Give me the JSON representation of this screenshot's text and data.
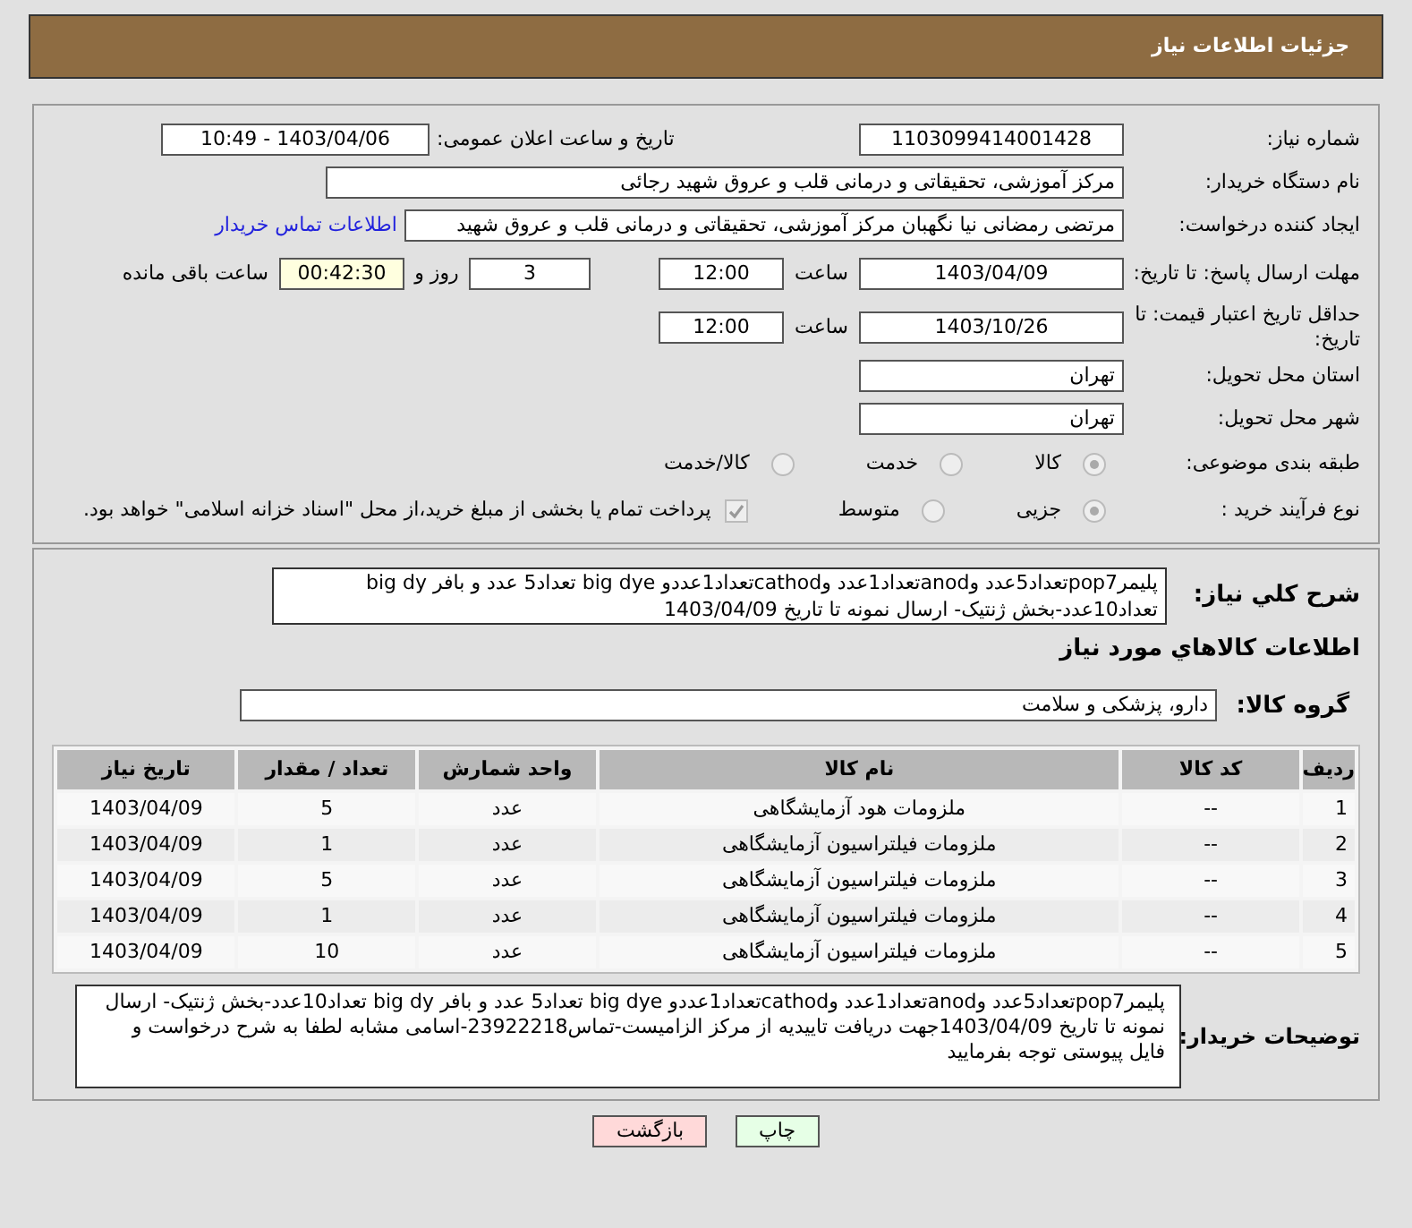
{
  "title": "جزئیات اطلاعات نیاز",
  "need_number": {
    "label": "شماره نیاز:",
    "value": "1103099414001428"
  },
  "announce": {
    "label": "تاریخ و ساعت اعلان عمومی:",
    "value": "1403/04/06 - 10:49"
  },
  "buyer_org": {
    "label": "نام دستگاه خریدار:",
    "value": "مرکز آموزشی، تحقیقاتی و درمانی قلب و عروق شهید رجائی"
  },
  "requester": {
    "label": "ایجاد کننده درخواست:",
    "value": "مرتضی رمضانی نیا نگهبان مرکز آموزشی، تحقیقاتی و درمانی قلب و عروق شهید",
    "link": "اطلاعات تماس خریدار"
  },
  "reply_deadline": {
    "label": "مهلت ارسال پاسخ: تا تاریخ:",
    "date": "1403/04/09",
    "time_label": "ساعت",
    "time": "12:00",
    "days": "3",
    "days_label": "روز و",
    "remaining": "00:42:30",
    "remaining_label": "ساعت باقی مانده"
  },
  "price_validity": {
    "label": "حداقل تاریخ اعتبار قیمت: تا تاریخ:",
    "date": "1403/10/26",
    "time_label": "ساعت",
    "time": "12:00"
  },
  "province": {
    "label": "استان محل تحویل:",
    "value": "تهران"
  },
  "city": {
    "label": "شهر محل تحویل:",
    "value": "تهران"
  },
  "category": {
    "label": "طبقه بندی موضوعی:",
    "options": [
      {
        "label": "کالا",
        "selected": true
      },
      {
        "label": "خدمت",
        "selected": false
      },
      {
        "label": "کالا/خدمت",
        "selected": false
      }
    ]
  },
  "purchase_type": {
    "label": "نوع فرآیند خرید :",
    "options": [
      {
        "label": "جزیی",
        "selected": true
      },
      {
        "label": "متوسط",
        "selected": false
      }
    ],
    "treasury": {
      "label": "پرداخت تمام یا بخشی از مبلغ خرید،از محل \"اسناد خزانه اسلامی\" خواهد بود.",
      "checked": true
    }
  },
  "description": {
    "label": "شرح کلي نياز:",
    "value": "پلیمرpop7تعداد5عدد وanodتعداد1عدد وcathodتعداد1عددو big dye تعداد5 عدد و بافر big dy تعداد10عدد-بخش ژنتیک- ارسال نمونه  تا تاریخ 1403/04/09"
  },
  "items_title": "اطلاعات کالاهاي مورد نياز",
  "goods_group": {
    "label": "گروه کالا:",
    "value": "دارو، پزشکی و سلامت"
  },
  "table": {
    "columns": [
      "ردیف",
      "کد کالا",
      "نام کالا",
      "واحد شمارش",
      "تعداد / مقدار",
      "تاریخ نیاز"
    ],
    "rows": [
      [
        "1",
        "--",
        "ملزومات هود آزمایشگاهی",
        "عدد",
        "5",
        "1403/04/09"
      ],
      [
        "2",
        "--",
        "ملزومات فیلتراسیون آزمایشگاهی",
        "عدد",
        "1",
        "1403/04/09"
      ],
      [
        "3",
        "--",
        "ملزومات فیلتراسیون آزمایشگاهی",
        "عدد",
        "5",
        "1403/04/09"
      ],
      [
        "4",
        "--",
        "ملزومات فیلتراسیون آزمایشگاهی",
        "عدد",
        "1",
        "1403/04/09"
      ],
      [
        "5",
        "--",
        "ملزومات فیلتراسیون آزمایشگاهی",
        "عدد",
        "10",
        "1403/04/09"
      ]
    ]
  },
  "buyer_notes": {
    "label": "توضیحات خریدار:",
    "value": "پلیمرpop7تعداد5عدد وanodتعداد1عدد وcathodتعداد1عددو big dye تعداد5 عدد و بافر big dy تعداد10عدد-بخش ژنتیک- ارسال نمونه  تا تاریخ 1403/04/09جهت دریافت تاییدیه از مرکز الزامیست-تماس23922218-اسامی مشابه لطفا به شرح درخواست و فایل پیوستی توجه بفرمایید"
  },
  "buttons": [
    {
      "label": "چاپ",
      "kind": "print"
    },
    {
      "label": "بازگشت",
      "kind": "back"
    }
  ]
}
